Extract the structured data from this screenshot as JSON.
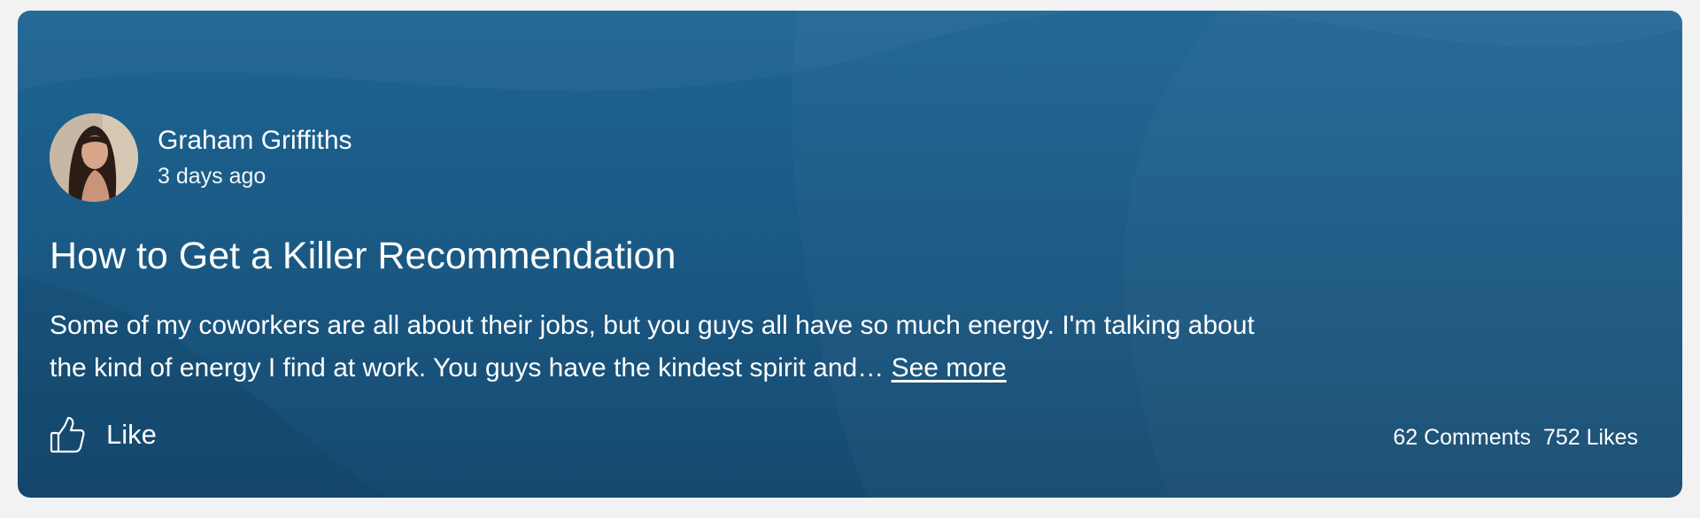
{
  "post": {
    "author_name": "Graham Griffiths",
    "time_ago": "3 days ago",
    "title": "How to Get a Killer Recommendation",
    "body": "Some of my coworkers are all about their jobs, but you guys all have so much energy. I'm talking about the kind of energy I find at work. You guys have the kindest spirit and…",
    "see_more_label": "See more",
    "like_label": "Like",
    "comments_label": "62 Comments",
    "likes_label": "752 Likes"
  },
  "icons": {
    "like": "thumbs-up-icon",
    "avatar": "avatar"
  },
  "colors": {
    "card_top": "#1e6594",
    "card_bottom": "#164a70",
    "text": "#ffffff",
    "page_bg": "#f2f2f2"
  }
}
